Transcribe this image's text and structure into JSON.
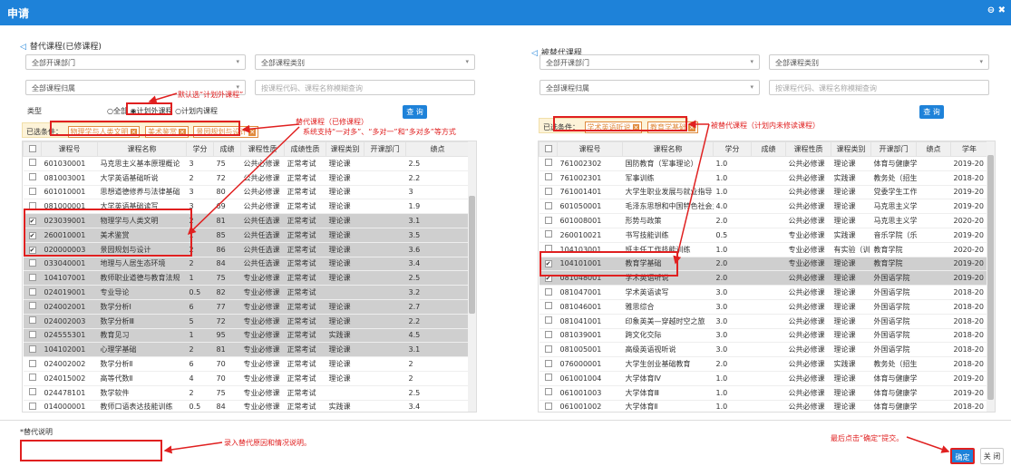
{
  "title": "申请",
  "window_icons": "⊖ ✖",
  "left": {
    "section_title": "替代课程(已修课程)",
    "dept_select": "全部开课部门",
    "category_select": "全部课程类别",
    "attribution_select": "全部课程归属",
    "search_placeholder": "按课程代码、课程名称模糊查询",
    "type_label": "类型",
    "radio_all": "全部",
    "radio_outside": "计划外课程",
    "radio_inside": "计划内课程",
    "query_button": "查 询",
    "conditions_label": "已选条件：",
    "condition_tags": [
      "物理学与人类文明",
      "美术鉴赏",
      "景园规划与设计"
    ],
    "columns": [
      "课程号",
      "课程名称",
      "学分",
      "成绩",
      "课程性质",
      "成绩性质",
      "课程类别",
      "开课部门",
      "绩点"
    ],
    "rows": [
      {
        "checked": false,
        "selected": false,
        "code": "601030001",
        "name": "马克思主义基本原理概论",
        "credit": "3",
        "score": "75",
        "nature": "公共必修课",
        "score_nature": "正常考试",
        "category": "理论课",
        "dept": "",
        "gpa": "2.5"
      },
      {
        "checked": false,
        "selected": false,
        "code": "081003001",
        "name": "大学英语基础听说",
        "credit": "2",
        "score": "72",
        "nature": "公共必修课",
        "score_nature": "正常考试",
        "category": "理论课",
        "dept": "",
        "gpa": "2.2"
      },
      {
        "checked": false,
        "selected": false,
        "code": "601010001",
        "name": "思想道德修养与法律基础",
        "credit": "3",
        "score": "80",
        "nature": "公共必修课",
        "score_nature": "正常考试",
        "category": "理论课",
        "dept": "",
        "gpa": "3"
      },
      {
        "checked": false,
        "selected": false,
        "code": "081000001",
        "name": "大学英语基础读写",
        "credit": "3",
        "score": "69",
        "nature": "公共必修课",
        "score_nature": "正常考试",
        "category": "理论课",
        "dept": "",
        "gpa": "1.9"
      },
      {
        "checked": true,
        "selected": true,
        "code": "023039001",
        "name": "物理学与人类文明",
        "credit": "2",
        "score": "81",
        "nature": "公共任选课",
        "score_nature": "正常考试",
        "category": "理论课",
        "dept": "",
        "gpa": "3.1"
      },
      {
        "checked": true,
        "selected": true,
        "code": "260010001",
        "name": "美术鉴赏",
        "credit": "1",
        "score": "85",
        "nature": "公共任选课",
        "score_nature": "正常考试",
        "category": "理论课",
        "dept": "",
        "gpa": "3.5"
      },
      {
        "checked": true,
        "selected": true,
        "code": "020000003",
        "name": "景园规划与设计",
        "credit": "2",
        "score": "86",
        "nature": "公共任选课",
        "score_nature": "正常考试",
        "category": "理论课",
        "dept": "",
        "gpa": "3.6"
      },
      {
        "checked": false,
        "selected": true,
        "code": "033040001",
        "name": "地理与人居生态环境",
        "credit": "2",
        "score": "84",
        "nature": "公共任选课",
        "score_nature": "正常考试",
        "category": "理论课",
        "dept": "",
        "gpa": "3.4"
      },
      {
        "checked": false,
        "selected": true,
        "code": "104107001",
        "name": "教师职业道德与教育法规",
        "credit": "1",
        "score": "75",
        "nature": "专业必修课",
        "score_nature": "正常考试",
        "category": "理论课",
        "dept": "",
        "gpa": "2.5"
      },
      {
        "checked": false,
        "selected": true,
        "code": "024019001",
        "name": "专业导论",
        "credit": "0.5",
        "score": "82",
        "nature": "专业必修课",
        "score_nature": "正常考试",
        "category": "",
        "dept": "",
        "gpa": "3.2"
      },
      {
        "checked": false,
        "selected": true,
        "code": "024002001",
        "name": "数学分析Ⅰ",
        "credit": "6",
        "score": "77",
        "nature": "专业必修课",
        "score_nature": "正常考试",
        "category": "理论课",
        "dept": "",
        "gpa": "2.7"
      },
      {
        "checked": false,
        "selected": true,
        "code": "024002003",
        "name": "数学分析Ⅲ",
        "credit": "5",
        "score": "72",
        "nature": "专业必修课",
        "score_nature": "正常考试",
        "category": "理论课",
        "dept": "",
        "gpa": "2.2"
      },
      {
        "checked": false,
        "selected": true,
        "code": "024555301",
        "name": "教育见习",
        "credit": "1",
        "score": "95",
        "nature": "专业必修课",
        "score_nature": "正常考试",
        "category": "实践课",
        "dept": "",
        "gpa": "4.5"
      },
      {
        "checked": false,
        "selected": true,
        "code": "104102001",
        "name": "心理学基础",
        "credit": "2",
        "score": "81",
        "nature": "专业必修课",
        "score_nature": "正常考试",
        "category": "理论课",
        "dept": "",
        "gpa": "3.1"
      },
      {
        "checked": false,
        "selected": false,
        "code": "024002002",
        "name": "数学分析Ⅱ",
        "credit": "6",
        "score": "70",
        "nature": "专业必修课",
        "score_nature": "正常考试",
        "category": "理论课",
        "dept": "",
        "gpa": "2"
      },
      {
        "checked": false,
        "selected": false,
        "code": "024015002",
        "name": "高等代数Ⅱ",
        "credit": "4",
        "score": "70",
        "nature": "专业必修课",
        "score_nature": "正常考试",
        "category": "理论课",
        "dept": "",
        "gpa": "2"
      },
      {
        "checked": false,
        "selected": false,
        "code": "024478101",
        "name": "数学软件",
        "credit": "2",
        "score": "75",
        "nature": "专业必修课",
        "score_nature": "正常考试",
        "category": "",
        "dept": "",
        "gpa": "2.5"
      },
      {
        "checked": false,
        "selected": false,
        "code": "014000001",
        "name": "教师口语表达技能训练",
        "credit": "0.5",
        "score": "84",
        "nature": "专业必修课",
        "score_nature": "正常考试",
        "category": "实践课",
        "dept": "",
        "gpa": "3.4"
      }
    ]
  },
  "right": {
    "section_title": "被替代课程",
    "dept_select": "全部开课部门",
    "category_select": "全部课程类别",
    "attribution_select": "全部课程归属",
    "search_placeholder": "按课程代码、课程名称模糊查询",
    "query_button": "查 询",
    "conditions_label": "已选条件：",
    "condition_tags": [
      "学术英语听说",
      "教育学基础"
    ],
    "columns": [
      "课程号",
      "课程名称",
      "学分",
      "成绩",
      "课程性质",
      "课程类别",
      "开课部门",
      "绩点",
      "学年"
    ],
    "rows": [
      {
        "checked": false,
        "selected": false,
        "code": "761002302",
        "name": "国防教育（军事理论）",
        "credit": "1.0",
        "score": "",
        "nature": "公共必修课",
        "category": "理论课",
        "dept": "体育与健康学",
        "gpa": "",
        "year": "2019-20"
      },
      {
        "checked": false,
        "selected": false,
        "code": "761002301",
        "name": "军事训练",
        "credit": "1.0",
        "score": "",
        "nature": "公共必修课",
        "category": "实践课",
        "dept": "教务处（招生",
        "gpa": "",
        "year": "2018-20"
      },
      {
        "checked": false,
        "selected": false,
        "code": "761001401",
        "name": "大学生职业发展与就业指导",
        "credit": "1.0",
        "score": "",
        "nature": "公共必修课",
        "category": "理论课",
        "dept": "党委学生工作",
        "gpa": "",
        "year": "2019-20"
      },
      {
        "checked": false,
        "selected": false,
        "code": "601050001",
        "name": "毛泽东思想和中国特色社会主义",
        "credit": "4.0",
        "score": "",
        "nature": "公共必修课",
        "category": "理论课",
        "dept": "马克思主义学",
        "gpa": "",
        "year": "2019-20"
      },
      {
        "checked": false,
        "selected": false,
        "code": "601008001",
        "name": "形势与政策",
        "credit": "2.0",
        "score": "",
        "nature": "公共必修课",
        "category": "理论课",
        "dept": "马克思主义学",
        "gpa": "",
        "year": "2020-20"
      },
      {
        "checked": false,
        "selected": false,
        "code": "260010021",
        "name": "书写技能训练",
        "credit": "0.5",
        "score": "",
        "nature": "专业必修课",
        "category": "实践课",
        "dept": "音乐学院（乐",
        "gpa": "",
        "year": "2019-20"
      },
      {
        "checked": false,
        "selected": false,
        "code": "104103001",
        "name": "班主任工作技能训练",
        "credit": "1.0",
        "score": "",
        "nature": "专业必修课",
        "category": "有实验（训",
        "dept": "教育学院",
        "gpa": "",
        "year": "2020-20"
      },
      {
        "checked": true,
        "selected": true,
        "code": "104101001",
        "name": "教育学基础",
        "credit": "2.0",
        "score": "",
        "nature": "专业必修课",
        "category": "理论课",
        "dept": "教育学院",
        "gpa": "",
        "year": "2019-20"
      },
      {
        "checked": true,
        "selected": true,
        "code": "081048001",
        "name": "学术英语听说",
        "credit": "2.0",
        "score": "",
        "nature": "公共必修课",
        "category": "理论课",
        "dept": "外国语学院",
        "gpa": "",
        "year": "2019-20"
      },
      {
        "checked": false,
        "selected": false,
        "code": "081047001",
        "name": "学术英语读写",
        "credit": "3.0",
        "score": "",
        "nature": "公共必修课",
        "category": "理论课",
        "dept": "外国语学院",
        "gpa": "",
        "year": "2018-20"
      },
      {
        "checked": false,
        "selected": false,
        "code": "081046001",
        "name": "雅思综合",
        "credit": "3.0",
        "score": "",
        "nature": "公共必修课",
        "category": "理论课",
        "dept": "外国语学院",
        "gpa": "",
        "year": "2018-20"
      },
      {
        "checked": false,
        "selected": false,
        "code": "081041001",
        "name": "印象英美—穿越时空之旅",
        "credit": "3.0",
        "score": "",
        "nature": "公共必修课",
        "category": "理论课",
        "dept": "外国语学院",
        "gpa": "",
        "year": "2018-20"
      },
      {
        "checked": false,
        "selected": false,
        "code": "081039001",
        "name": "跨文化交际",
        "credit": "3.0",
        "score": "",
        "nature": "公共必修课",
        "category": "理论课",
        "dept": "外国语学院",
        "gpa": "",
        "year": "2018-20"
      },
      {
        "checked": false,
        "selected": false,
        "code": "081005001",
        "name": "高级英语视听说",
        "credit": "3.0",
        "score": "",
        "nature": "公共必修课",
        "category": "理论课",
        "dept": "外国语学院",
        "gpa": "",
        "year": "2018-20"
      },
      {
        "checked": false,
        "selected": false,
        "code": "076000001",
        "name": "大学生创业基础教育",
        "credit": "2.0",
        "score": "",
        "nature": "公共必修课",
        "category": "实践课",
        "dept": "教务处（招生",
        "gpa": "",
        "year": "2018-20"
      },
      {
        "checked": false,
        "selected": false,
        "code": "061001004",
        "name": "大学体育Ⅳ",
        "credit": "1.0",
        "score": "",
        "nature": "公共必修课",
        "category": "理论课",
        "dept": "体育与健康学",
        "gpa": "",
        "year": "2019-20"
      },
      {
        "checked": false,
        "selected": false,
        "code": "061001003",
        "name": "大学体育Ⅲ",
        "credit": "1.0",
        "score": "",
        "nature": "公共必修课",
        "category": "理论课",
        "dept": "体育与健康学",
        "gpa": "",
        "year": "2019-20"
      },
      {
        "checked": false,
        "selected": false,
        "code": "061001002",
        "name": "大学体育Ⅱ",
        "credit": "1.0",
        "score": "",
        "nature": "公共必修课",
        "category": "理论课",
        "dept": "体育与健康学",
        "gpa": "",
        "year": "2018-20"
      }
    ]
  },
  "annotations": {
    "default_outside": "默认选“计划外课程”",
    "substitute_title": "替代课程（已修课程）",
    "substitute_desc": "系统支持“一对多”、“多对一”和“多对多”等方式",
    "replaced": "被替代课程（计划内未修读课程）",
    "reason": "录入替代原因和情况说明。",
    "confirm": "最后点击“确定”提交。"
  },
  "footer": {
    "reason_label": "*替代说明",
    "confirm_button": "确定",
    "close_button": "关 闭"
  },
  "colors": {
    "accent": "#1e82d9",
    "annotation": "#e02020",
    "tag": "#e08a3c"
  }
}
